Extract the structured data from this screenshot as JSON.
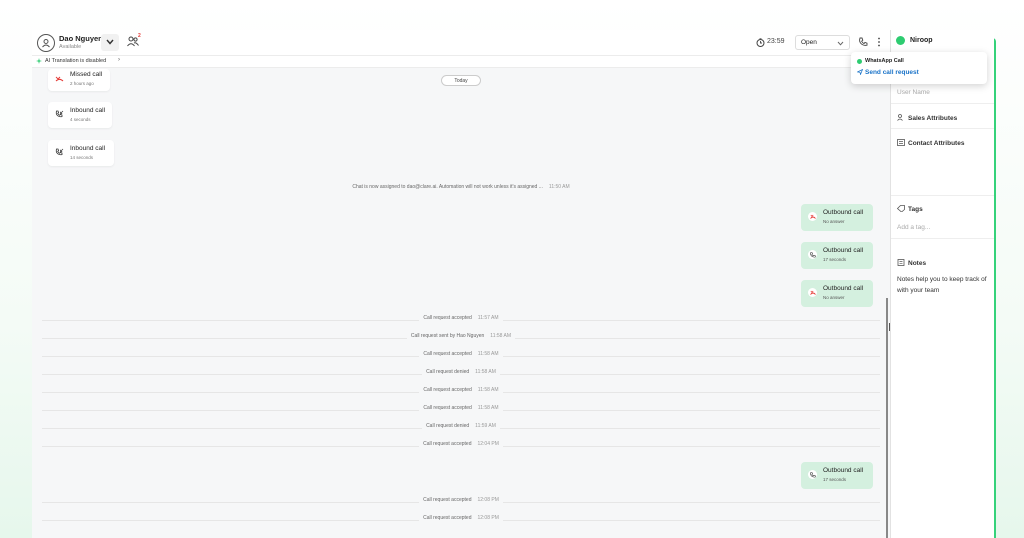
{
  "header": {
    "user_name": "Dao Nguyen",
    "user_status": "Available",
    "team_badge": "2",
    "timer": "23:59",
    "status_value": "Open"
  },
  "translation": {
    "text": "AI Translation is disabled",
    "chevron": "›"
  },
  "chat": {
    "date_pill": "Today",
    "inbound_cards": [
      {
        "title": "Missed call",
        "sub": "2 hours ago",
        "icon": "missed-call-icon"
      },
      {
        "title": "Inbound call",
        "sub": "4 seconds",
        "icon": "inbound-call-icon"
      },
      {
        "title": "Inbound call",
        "sub": "14 seconds",
        "icon": "inbound-call-icon"
      }
    ],
    "assign_msg": {
      "text": "Chat is now assigned to dao@clare.ai. Automation will not work unless it's assigned ...",
      "time": "11:50 AM"
    },
    "outbound_cards": [
      {
        "title": "Outbound call",
        "sub": "No answer",
        "icon": "missed-call-icon"
      },
      {
        "title": "Outbound call",
        "sub": "17 seconds",
        "icon": "phone-icon"
      },
      {
        "title": "Outbound call",
        "sub": "No answer",
        "icon": "missed-call-icon"
      },
      {
        "title": "Outbound call",
        "sub": "17 seconds",
        "icon": "phone-icon"
      }
    ],
    "events": [
      {
        "text": "Call request accepted",
        "time": "11:57 AM"
      },
      {
        "text": "Call request sent by Hao Nguyen",
        "time": "11:58 AM"
      },
      {
        "text": "Call request accepted",
        "time": "11:58 AM"
      },
      {
        "text": "Call request denied",
        "time": "11:58 AM"
      },
      {
        "text": "Call request accepted",
        "time": "11:58 AM"
      },
      {
        "text": "Call request accepted",
        "time": "11:58 AM"
      },
      {
        "text": "Call request denied",
        "time": "11:59 AM"
      },
      {
        "text": "Call request accepted",
        "time": "12:04 PM"
      },
      {
        "text": "Call request accepted",
        "time": "12:08 PM"
      },
      {
        "text": "Call request accepted",
        "time": "12:08 PM"
      }
    ]
  },
  "sidebar": {
    "name": "Niroop",
    "username_label": "User Name",
    "sales_attributes": "Sales Attributes",
    "contact_attributes": "Contact Attributes",
    "tags": "Tags",
    "tags_placeholder": "Add a tag...",
    "notes": "Notes",
    "notes_help": "Notes help you to keep track of with your team"
  },
  "popover": {
    "title": "WhatsApp Call",
    "send": "Send call request"
  },
  "colors": {
    "accent_green": "#35d27a",
    "outbound_bg": "#d4f0df",
    "link_blue": "#1a73c8",
    "missed_red": "#e53935"
  }
}
